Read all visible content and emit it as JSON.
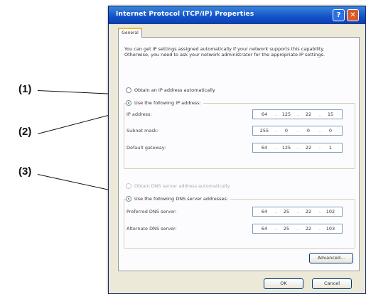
{
  "callouts": [
    "(1)",
    "(2)",
    "(3)"
  ],
  "window": {
    "title": "Internet Protocol (TCP/IP) Properties",
    "help_glyph": "?",
    "close_glyph": "✕"
  },
  "tab": {
    "label": "General"
  },
  "description": "You can get IP settings assigned automatically if your network supports this capability. Otherwise, you need to ask your network administrator for the appropriate IP settings.",
  "ip_options": {
    "auto_label": "Obtain an IP address automatically",
    "auto_selected": false,
    "manual_label": "Use the following IP address:",
    "manual_selected": true
  },
  "ip_fields": [
    {
      "label": "IP address:",
      "octets": [
        "64",
        "125",
        "22",
        "15"
      ]
    },
    {
      "label": "Subnet mask:",
      "octets": [
        "255",
        "0",
        "0",
        "0"
      ]
    },
    {
      "label": "Default gateway:",
      "octets": [
        "64",
        "125",
        "22",
        "1"
      ]
    }
  ],
  "dns_options": {
    "auto_label": "Obtain DNS server address automatically",
    "auto_selected": false,
    "auto_enabled": false,
    "manual_label": "Use the following DNS server addresses:",
    "manual_selected": true
  },
  "dns_fields": [
    {
      "label": "Preferred DNS server:",
      "octets": [
        "64",
        "25",
        "22",
        "102"
      ]
    },
    {
      "label": "Alternate DNS server:",
      "octets": [
        "64",
        "25",
        "22",
        "103"
      ]
    }
  ],
  "buttons": {
    "advanced": "Advanced...",
    "ok": "OK",
    "cancel": "Cancel"
  }
}
